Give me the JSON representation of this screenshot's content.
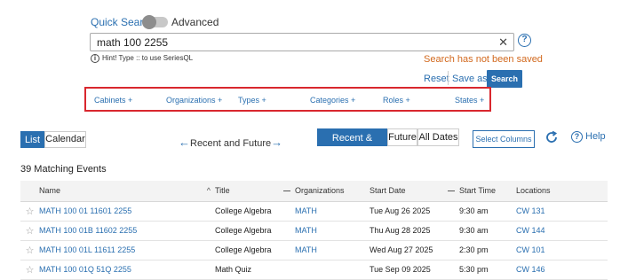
{
  "quick_search": {
    "quick_label": "Quick Search",
    "advanced_label": "Advanced",
    "query": "math 100 2255",
    "hint": "Hint! Type :: to use SeriesQL",
    "status": "Search has not been saved",
    "reset_label": "Reset",
    "save_as_label": "Save as",
    "search_label": "Search"
  },
  "filters": [
    {
      "label": "Cabinets +"
    },
    {
      "label": "Organizations +"
    },
    {
      "label": "Types +"
    },
    {
      "label": "Categories +"
    },
    {
      "label": "Roles +"
    },
    {
      "label": "States +"
    }
  ],
  "view": {
    "list_label": "List",
    "calendar_label": "Calendar",
    "range_label": "Recent and Future",
    "segments": [
      "Recent & Future",
      "Future",
      "All Dates"
    ],
    "select_columns_label": "Select Columns",
    "help_label": "Help"
  },
  "results": {
    "count_text": "39 Matching Events",
    "columns": {
      "name": "Name",
      "title": "Title",
      "organizations": "Organizations",
      "start_date": "Start Date",
      "start_time": "Start Time",
      "locations": "Locations"
    },
    "rows": [
      {
        "name": "MATH 100 01 11601 2255",
        "title": "College Algebra",
        "org": "MATH",
        "date": "Tue Aug 26 2025",
        "time": "9:30 am",
        "loc": "CW 131"
      },
      {
        "name": "MATH 100 01B 11602 2255",
        "title": "College Algebra",
        "org": "MATH",
        "date": "Thu Aug 28 2025",
        "time": "9:30 am",
        "loc": "CW 144"
      },
      {
        "name": "MATH 100 01L 11611 2255",
        "title": "College Algebra",
        "org": "MATH",
        "date": "Wed Aug 27 2025",
        "time": "2:30 pm",
        "loc": "CW 101"
      },
      {
        "name": "MATH 100 01Q 51Q 2255",
        "title": "Math Quiz",
        "org": "",
        "date": "Tue Sep 09 2025",
        "time": "5:30 pm",
        "loc": "CW 146"
      }
    ]
  },
  "colors": {
    "accent": "#2a6fb0",
    "warning": "#d2691e",
    "highlight_border": "#d9272e"
  }
}
